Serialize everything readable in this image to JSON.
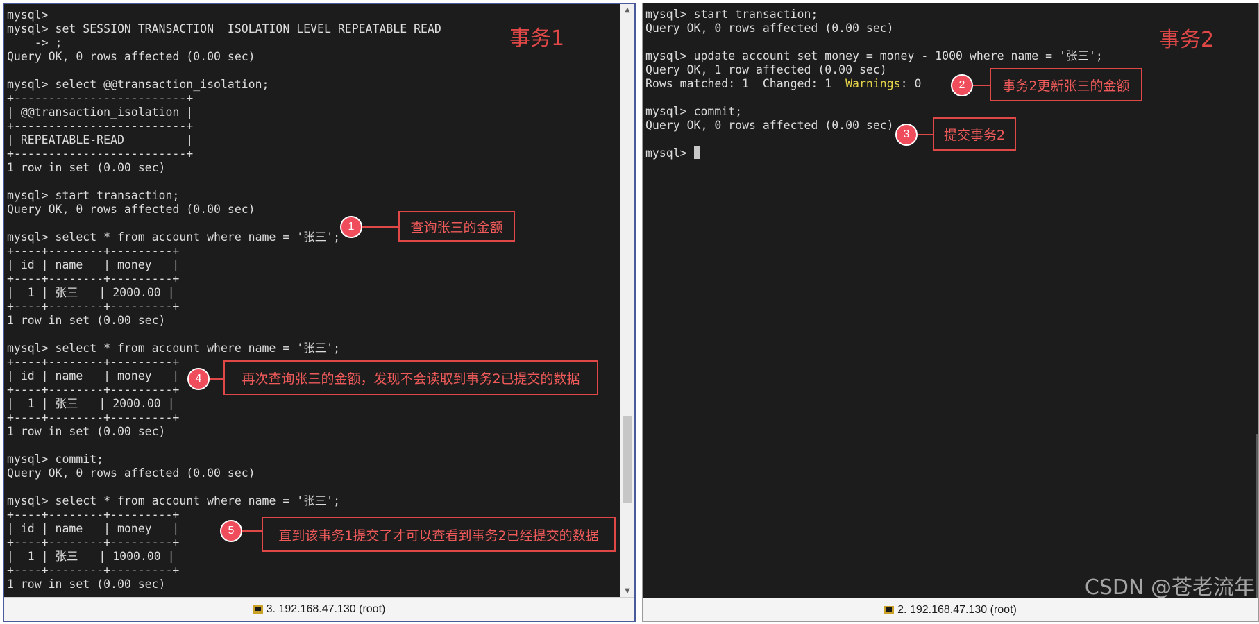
{
  "transaction1": {
    "title": "事务1",
    "lines": [
      "mysql>",
      "mysql> set SESSION TRANSACTION  ISOLATION LEVEL REPEATABLE READ",
      "    -> ;",
      "Query OK, 0 rows affected (0.00 sec)",
      "",
      "mysql> select @@transaction_isolation;",
      "+-------------------------+",
      "| @@transaction_isolation |",
      "+-------------------------+",
      "| REPEATABLE-READ         |",
      "+-------------------------+",
      "1 row in set (0.00 sec)",
      "",
      "mysql> start transaction;",
      "Query OK, 0 rows affected (0.00 sec)",
      "",
      "mysql> select * from account where name = '张三';",
      "+----+--------+---------+",
      "| id | name   | money   |",
      "+----+--------+---------+",
      "|  1 | 张三   | 2000.00 |",
      "+----+--------+---------+",
      "1 row in set (0.00 sec)",
      "",
      "mysql> select * from account where name = '张三';",
      "+----+--------+---------+",
      "| id | name   | money   |",
      "+----+--------+---------+",
      "|  1 | 张三   | 2000.00 |",
      "+----+--------+---------+",
      "1 row in set (0.00 sec)",
      "",
      "mysql> commit;",
      "Query OK, 0 rows affected (0.00 sec)",
      "",
      "mysql> select * from account where name = '张三';",
      "+----+--------+---------+",
      "| id | name   | money   |",
      "+----+--------+---------+",
      "|  1 | 张三   | 1000.00 |",
      "+----+--------+---------+",
      "1 row in set (0.00 sec)"
    ],
    "status_label": "3. 192.168.47.130 (root)",
    "scroll_position": 0.83
  },
  "transaction2": {
    "title": "事务2",
    "lines": [
      "mysql> start transaction;",
      "Query OK, 0 rows affected (0.00 sec)",
      "",
      "mysql> update account set money = money - 1000 where name = '张三';",
      "Query OK, 1 row affected (0.00 sec)",
      "Rows matched: 1  Changed: 1  ",
      "",
      "mysql> commit;",
      "Query OK, 0 rows affected (0.00 sec)",
      "",
      "mysql> "
    ],
    "warnings_label": "Warnings",
    "warnings_value": ": 0",
    "status_label": "2. 192.168.47.130 (root)"
  },
  "annotations": [
    {
      "num": "1",
      "text": "查询张三的金额"
    },
    {
      "num": "2",
      "text": "事务2更新张三的金额"
    },
    {
      "num": "3",
      "text": "提交事务2"
    },
    {
      "num": "4",
      "text": "再次查询张三的金额，发现不会读取到事务2已提交的数据"
    },
    {
      "num": "5",
      "text": "直到该事务1提交了才可以查看到事务2已经提交的数据"
    }
  ],
  "watermark": "CSDN @苍老流年",
  "colors": {
    "terminal_bg": "#1c1c1c",
    "annotation": "#e04848",
    "marker": "#ef4c5c",
    "warning": "#e4d34a"
  }
}
